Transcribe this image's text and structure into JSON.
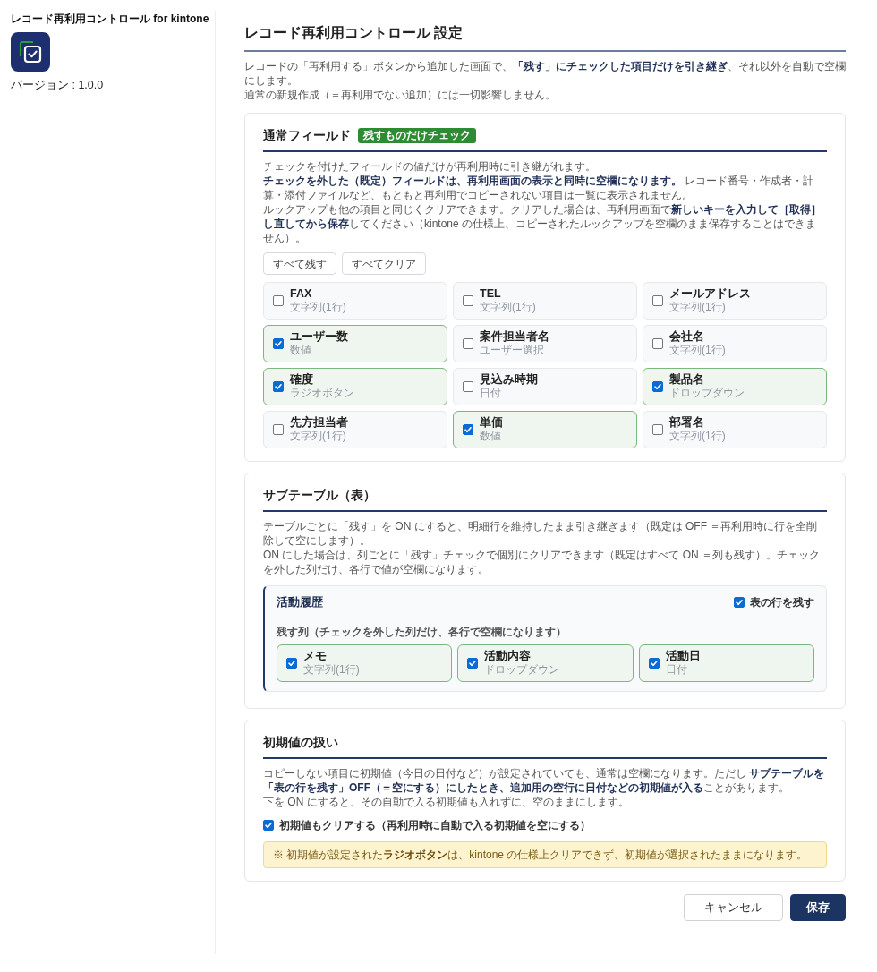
{
  "sidebar": {
    "title": "レコード再利用コントロール for kintone",
    "version": "バージョン : 1.0.0"
  },
  "header": {
    "title": "レコード再利用コントロール 設定",
    "description": [
      "レコードの「再利用する」ボタンから追加した画面で、**「残す」にチェックした項目だけを引き継ぎ**、それ以外を自動で空欄にします。",
      "通常の新規作成（＝再利用でない追加）には一切影響しません。"
    ]
  },
  "normal_fields": {
    "title": "通常フィールド",
    "badge": "残すものだけチェック",
    "paragraphs": [
      "チェックを付けたフィールドの値だけが再利用時に引き継がれます。",
      "**チェックを外した（既定）フィールドは、再利用画面の表示と同時に空欄になります。** レコード番号・作成者・計算・添付ファイルなど、もともと再利用でコピーされない項目は一覧に表示されません。",
      "ルックアップも他の項目と同じくクリアできます。クリアした場合は、再利用画面で**新しいキーを入力して［取得］し直してから保存**してください（kintone の仕様上、コピーされたルックアップを空欄のまま保存することはできません）。"
    ],
    "bulk_buttons": [
      "すべて残す",
      "すべてクリア"
    ],
    "fields": [
      {
        "label": "FAX",
        "field_type": "文字列(1行)",
        "checked": false
      },
      {
        "label": "TEL",
        "field_type": "文字列(1行)",
        "checked": false
      },
      {
        "label": "メールアドレス",
        "field_type": "文字列(1行)",
        "checked": false
      },
      {
        "label": "ユーザー数",
        "field_type": "数値",
        "checked": true
      },
      {
        "label": "案件担当者名",
        "field_type": "ユーザー選択",
        "checked": false
      },
      {
        "label": "会社名",
        "field_type": "文字列(1行)",
        "checked": false
      },
      {
        "label": "確度",
        "field_type": "ラジオボタン",
        "checked": true
      },
      {
        "label": "見込み時期",
        "field_type": "日付",
        "checked": false
      },
      {
        "label": "製品名",
        "field_type": "ドロップダウン",
        "checked": true
      },
      {
        "label": "先方担当者",
        "field_type": "文字列(1行)",
        "checked": false
      },
      {
        "label": "単価",
        "field_type": "数値",
        "checked": true
      },
      {
        "label": "部署名",
        "field_type": "文字列(1行)",
        "checked": false
      }
    ]
  },
  "subtable_section": {
    "title": "サブテーブル（表）",
    "paragraphs": [
      "テーブルごとに「残す」を ON にすると、明細行を維持したまま引き継ぎます（既定は OFF ＝再利用時に行を全削除して空にします）。",
      "ON にした場合は、列ごとに「残す」チェックで個別にクリアできます（既定はすべて ON ＝列も残す）。チェックを外した列だけ、各行で値が空欄になります。"
    ],
    "tables": [
      {
        "name": "活動履歴",
        "keep_rows": {
          "label": "表の行を残す",
          "checked": true
        },
        "columns_label": "残す列（チェックを外した列だけ、各行で空欄になります）",
        "columns": [
          {
            "label": "メモ",
            "field_type": "文字列(1行)",
            "checked": true
          },
          {
            "label": "活動内容",
            "field_type": "ドロップダウン",
            "checked": true
          },
          {
            "label": "活動日",
            "field_type": "日付",
            "checked": true
          }
        ]
      }
    ]
  },
  "initial_values": {
    "title": "初期値の扱い",
    "paragraphs": [
      "コピーしない項目に初期値（今日の日付など）が設定されていても、通常は空欄になります。ただし **サブテーブルを「表の行を残す」OFF（＝空にする）にしたとき、追加用の空行に日付などの初期値が入る**ことがあります。",
      "下を ON にすると、その自動で入る初期値も入れずに、空のままにします。"
    ],
    "option": {
      "label": "初期値もクリアする（再利用時に自動で入る初期値を空にする）",
      "checked": true
    },
    "note": "※ 初期値が設定された**ラジオボタン**は、kintone の仕様上クリアできず、初期値が選択されたままになります。"
  },
  "actions": [
    {
      "label": "キャンセル",
      "kind": "secondary"
    },
    {
      "label": "保存",
      "kind": "primary"
    }
  ]
}
